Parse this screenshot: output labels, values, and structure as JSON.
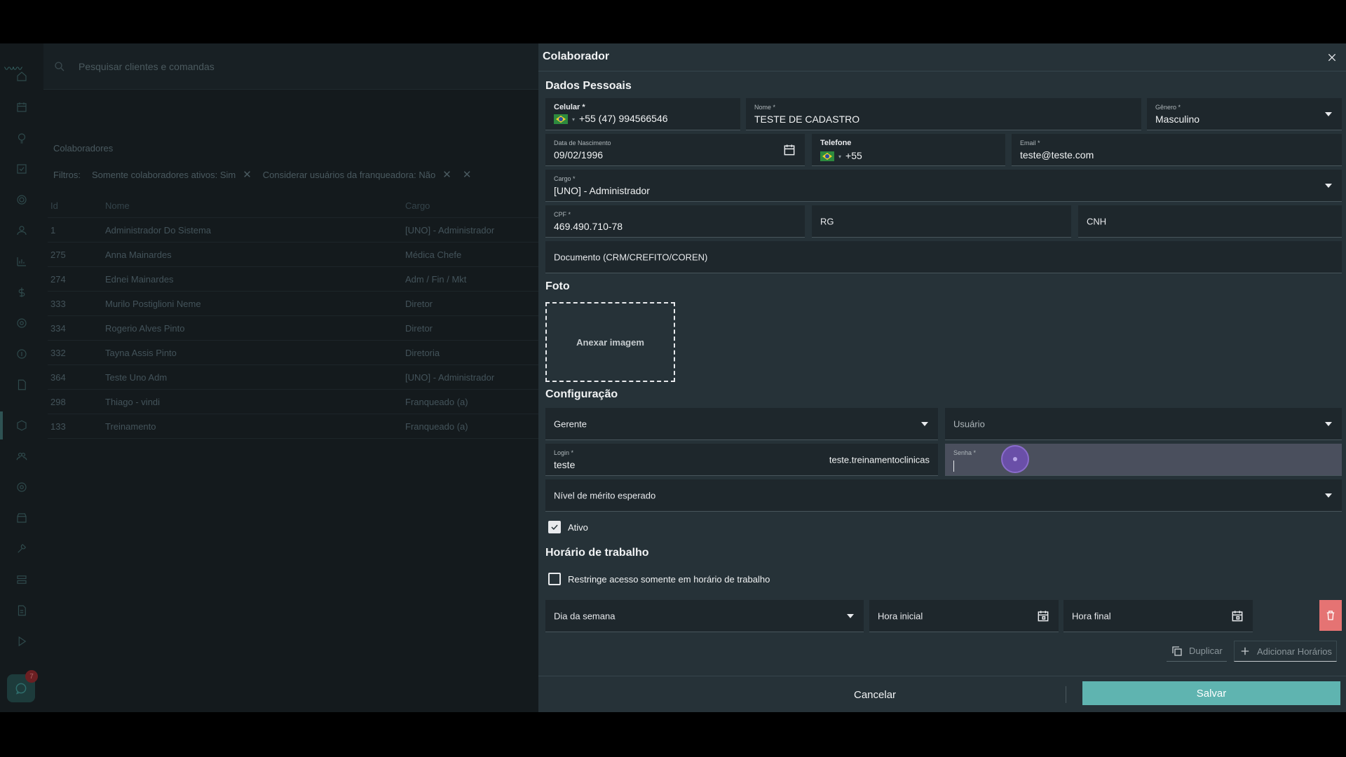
{
  "background": {
    "search_placeholder": "Pesquisar clientes e comandas",
    "list_title": "Colaboradores",
    "filters_label": "Filtros:",
    "filter_chips": [
      "Somente colaboradores ativos: Sim",
      "Considerar usuários da franqueadora: Não"
    ],
    "columns": [
      "Id",
      "Nome",
      "Cargo"
    ],
    "rows": [
      {
        "id": "1",
        "nome": "Administrador Do Sistema",
        "cargo": "[UNO] - Administrador"
      },
      {
        "id": "275",
        "nome": "Anna Mainardes",
        "cargo": "Médica Chefe"
      },
      {
        "id": "274",
        "nome": "Ednei Mainardes",
        "cargo": "Adm / Fin / Mkt"
      },
      {
        "id": "333",
        "nome": "Murilo Postiglioni Neme",
        "cargo": "Diretor"
      },
      {
        "id": "334",
        "nome": "Rogerio Alves Pinto",
        "cargo": "Diretor"
      },
      {
        "id": "332",
        "nome": "Tayna Assis Pinto",
        "cargo": "Diretoria"
      },
      {
        "id": "364",
        "nome": "Teste Uno Adm",
        "cargo": "[UNO] - Administrador"
      },
      {
        "id": "298",
        "nome": "Thiago - vindi",
        "cargo": "Franqueado (a)"
      },
      {
        "id": "133",
        "nome": "Treinamento",
        "cargo": "Franqueado (a)"
      }
    ],
    "chat_badge": "7"
  },
  "modal": {
    "title": "Colaborador",
    "sections": {
      "dados": "Dados Pessoais",
      "foto": "Foto",
      "config": "Configuração",
      "horario": "Horário de trabalho"
    },
    "celular": {
      "label": "Celular *",
      "value": "+55 (47) 994566546"
    },
    "nome": {
      "label": "Nome *",
      "value": "TESTE DE CADASTRO"
    },
    "genero": {
      "label": "Gênero *",
      "value": "Masculino"
    },
    "nascimento": {
      "label": "Data de Nascimento",
      "value": "09/02/1996"
    },
    "telefone": {
      "label": "Telefone",
      "value": "+55"
    },
    "email": {
      "label": "Email *",
      "value": "teste@teste.com"
    },
    "cargo": {
      "label": "Cargo *",
      "value": "[UNO] - Administrador"
    },
    "cpf": {
      "label": "CPF *",
      "value": "469.490.710-78"
    },
    "rg": {
      "placeholder": "RG"
    },
    "cnh": {
      "placeholder": "CNH"
    },
    "documento": {
      "placeholder": "Documento (CRM/CREFITO/COREN)"
    },
    "anexar": "Anexar imagem",
    "perfil": {
      "value": "Gerente"
    },
    "usuario": {
      "placeholder": "Usuário"
    },
    "login": {
      "label": "Login *",
      "value": "teste",
      "suffix": "teste.treinamentoclinicas"
    },
    "senha": {
      "label": "Senha *"
    },
    "merito": {
      "placeholder": "Nível de mérito esperado"
    },
    "ativo": {
      "label": "Ativo",
      "checked": true
    },
    "restringe": {
      "label": "Restringe acesso somente em horário de trabalho",
      "checked": false
    },
    "dia_semana": {
      "placeholder": "Dia da semana"
    },
    "hora_inicial": {
      "placeholder": "Hora inicial"
    },
    "hora_final": {
      "placeholder": "Hora final"
    },
    "duplicar": "Duplicar",
    "adicionar": "Adicionar Horários",
    "cancelar": "Cancelar",
    "salvar": "Salvar"
  },
  "colors": {
    "accent": "#5fb4b0",
    "danger": "#e57373",
    "modal_bg": "#263238"
  }
}
